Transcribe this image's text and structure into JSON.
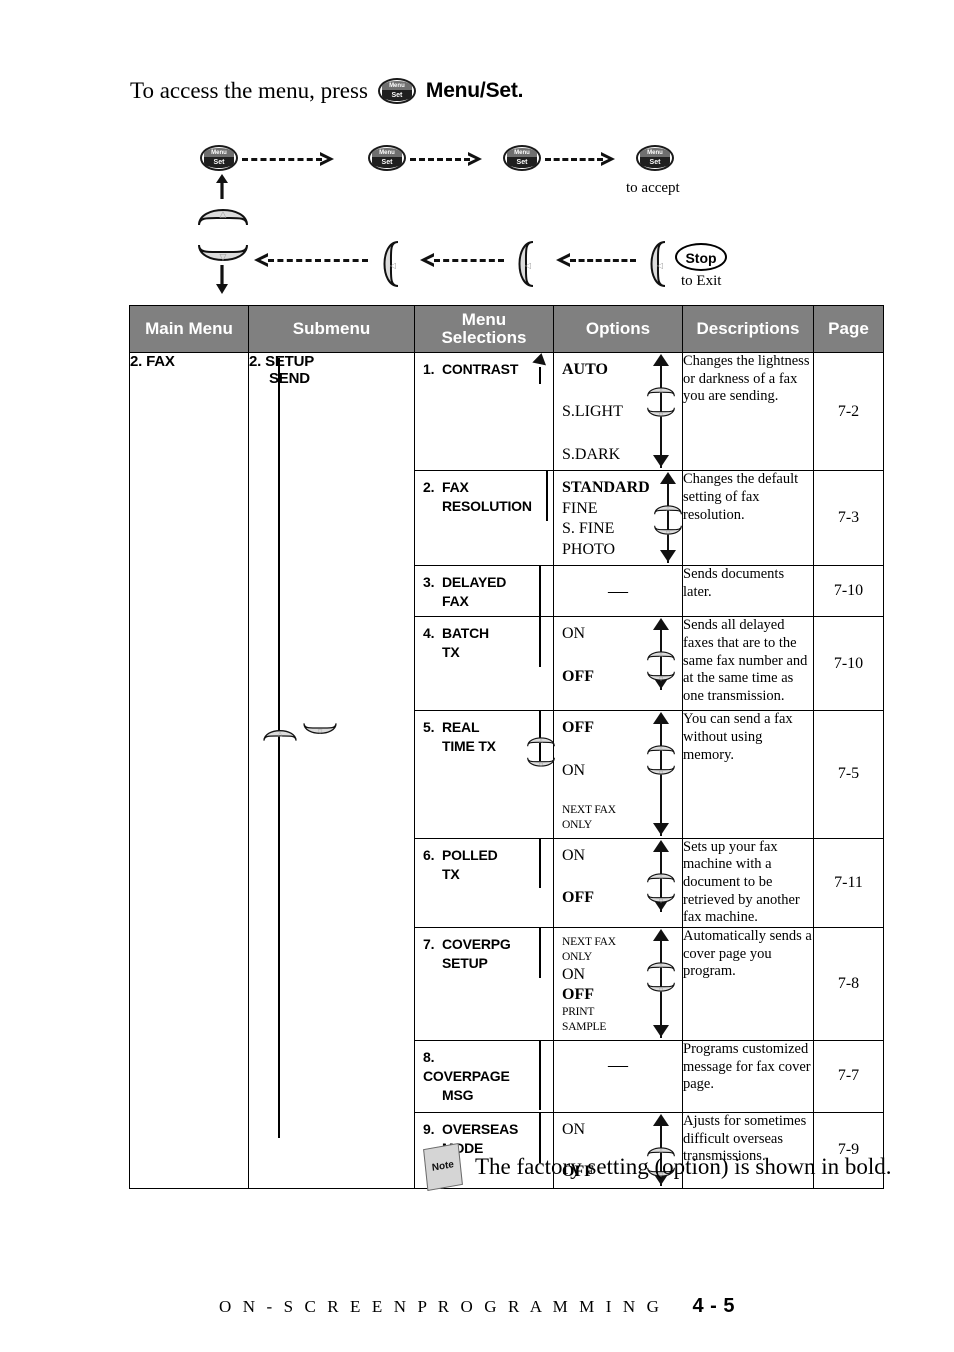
{
  "intro": {
    "text_before": "To access the menu, press",
    "key_label_top": "Menu",
    "key_label_bottom": "Set",
    "bold_label": "Menu/Set",
    "period": "."
  },
  "diagram": {
    "menu_key": {
      "top": "Menu",
      "bottom": "Set"
    },
    "accept_caption": "to accept",
    "stop_label": "Stop",
    "exit_caption": "to Exit",
    "up_key_glyph": "▲",
    "down_key_glyph": "▼",
    "left_key_glyph": "◀"
  },
  "table": {
    "headers": {
      "main_menu": "Main Menu",
      "submenu": "Submenu",
      "menu_selections_l1": "Menu",
      "menu_selections_l2": "Selections",
      "options": "Options",
      "descriptions": "Descriptions",
      "page": "Page"
    },
    "main_menu": "2. FAX",
    "submenu_l1": "2. SETUP",
    "submenu_l2": "SEND",
    "rows": [
      {
        "num": "1.",
        "sel_l1": "CONTRAST",
        "sel_l2": "",
        "options": [
          "AUTO",
          "S.LIGHT",
          "S.DARK"
        ],
        "bold": [
          true,
          false,
          false
        ],
        "small": [
          false,
          false,
          false
        ],
        "spaced": true,
        "dash": false,
        "description": "Changes the lightness or darkness of a fax you are sending.",
        "page": "7-2"
      },
      {
        "num": "2.",
        "sel_l1": "FAX",
        "sel_l2": "RESOLUTION",
        "options": [
          "STANDARD",
          "FINE",
          "S. FINE",
          "PHOTO"
        ],
        "bold": [
          true,
          false,
          false,
          false
        ],
        "small": [
          false,
          false,
          false,
          false
        ],
        "spaced": false,
        "dash": false,
        "description": "Changes the default setting of fax resolution.",
        "page": "7-3"
      },
      {
        "num": "3.",
        "sel_l1": "DELAYED",
        "sel_l2": "FAX",
        "options": [],
        "bold": [],
        "small": [],
        "spaced": false,
        "dash": true,
        "description": "Sends documents later.",
        "page": "7-10"
      },
      {
        "num": "4.",
        "sel_l1": "BATCH",
        "sel_l2": "TX",
        "options": [
          "ON",
          "OFF"
        ],
        "bold": [
          false,
          true
        ],
        "small": [
          false,
          false
        ],
        "spaced": true,
        "dash": false,
        "description": "Sends all delayed faxes that are to the same fax number and at the same time as one transmission.",
        "page": "7-10"
      },
      {
        "num": "5.",
        "sel_l1": "REAL",
        "sel_l2": "TIME TX",
        "options": [
          "OFF",
          "ON",
          "NEXT FAX ONLY"
        ],
        "bold": [
          true,
          false,
          false
        ],
        "small": [
          false,
          false,
          true
        ],
        "spaced": true,
        "dash": false,
        "description": "You can send a fax without using memory.",
        "page": "7-5"
      },
      {
        "num": "6.",
        "sel_l1": "POLLED",
        "sel_l2": "TX",
        "options": [
          "ON",
          "OFF"
        ],
        "bold": [
          false,
          true
        ],
        "small": [
          false,
          false
        ],
        "spaced": true,
        "dash": false,
        "description": "Sets up your fax machine with a document to be retrieved by another fax machine.",
        "page": "7-11"
      },
      {
        "num": "7.",
        "sel_l1": "COVERPG",
        "sel_l2": "SETUP",
        "options": [
          "NEXT FAX ONLY",
          "ON",
          "OFF",
          "PRINT SAMPLE"
        ],
        "bold": [
          false,
          false,
          true,
          false
        ],
        "small": [
          true,
          false,
          false,
          true
        ],
        "spaced": false,
        "dash": false,
        "description": "Automatically sends a cover page you program.",
        "page": "7-8"
      },
      {
        "num": "8.",
        "sel_l1": "COVERPAGE",
        "sel_l2": "MSG",
        "options": [],
        "bold": [],
        "small": [],
        "spaced": false,
        "dash": true,
        "description": "Programs customized message for fax cover page.",
        "page": "7-7"
      },
      {
        "num": "9.",
        "sel_l1": "OVERSEAS",
        "sel_l2": "MODE",
        "options": [
          "ON",
          "OFF"
        ],
        "bold": [
          false,
          true
        ],
        "small": [
          false,
          false
        ],
        "spaced": true,
        "dash": false,
        "description": "Ajusts for sometimes difficult overseas transmissions.",
        "page": "7-9"
      }
    ],
    "dash_symbol": "—"
  },
  "note": {
    "icon_label": "Note",
    "text": "The factory setting (option) is shown in bold."
  },
  "footer": {
    "title": "O N - S C R E E N   P R O G R A M M I N G",
    "page_number": "4 - 5"
  },
  "colors": {
    "header_bg": "#808080",
    "header_text": "#ffffff",
    "key_gray": "#d5d5d5",
    "line": "#000000"
  }
}
